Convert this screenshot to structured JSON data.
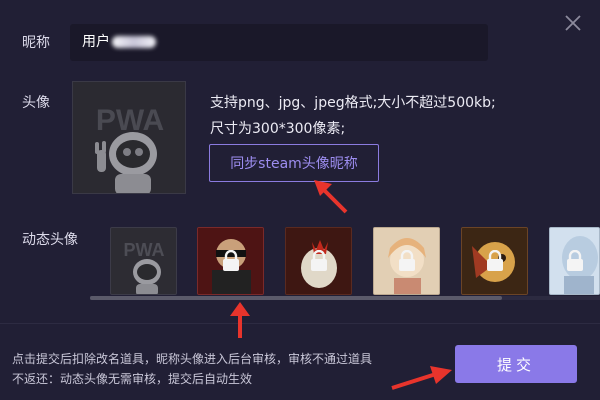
{
  "form": {
    "nickname_label": "昵称",
    "nickname_value": "用户",
    "avatar_label": "头像",
    "avatar_text": "PWA",
    "hint_line1": "支持png、jpg、jpeg格式;大小不超过500kb;",
    "hint_line2": "尺寸为300*300像素;",
    "sync_button": "同步steam头像昵称",
    "dynamic_label": "动态头像",
    "thumb_text": "PWA"
  },
  "footer": {
    "notice_line1": "点击提交后扣除改名道具，昵称头像进入后台审核，审核不通过道具",
    "notice_line2": "不返还：动态头像无需审核，提交后自动生效",
    "submit_label": "提交"
  },
  "colors": {
    "background": "#211f35",
    "accent": "#8a79e8",
    "annotation_arrow": "#e8342c"
  },
  "icons": [
    "close-icon",
    "lock-icon",
    "astronaut-avatar",
    "annotation-arrow"
  ]
}
